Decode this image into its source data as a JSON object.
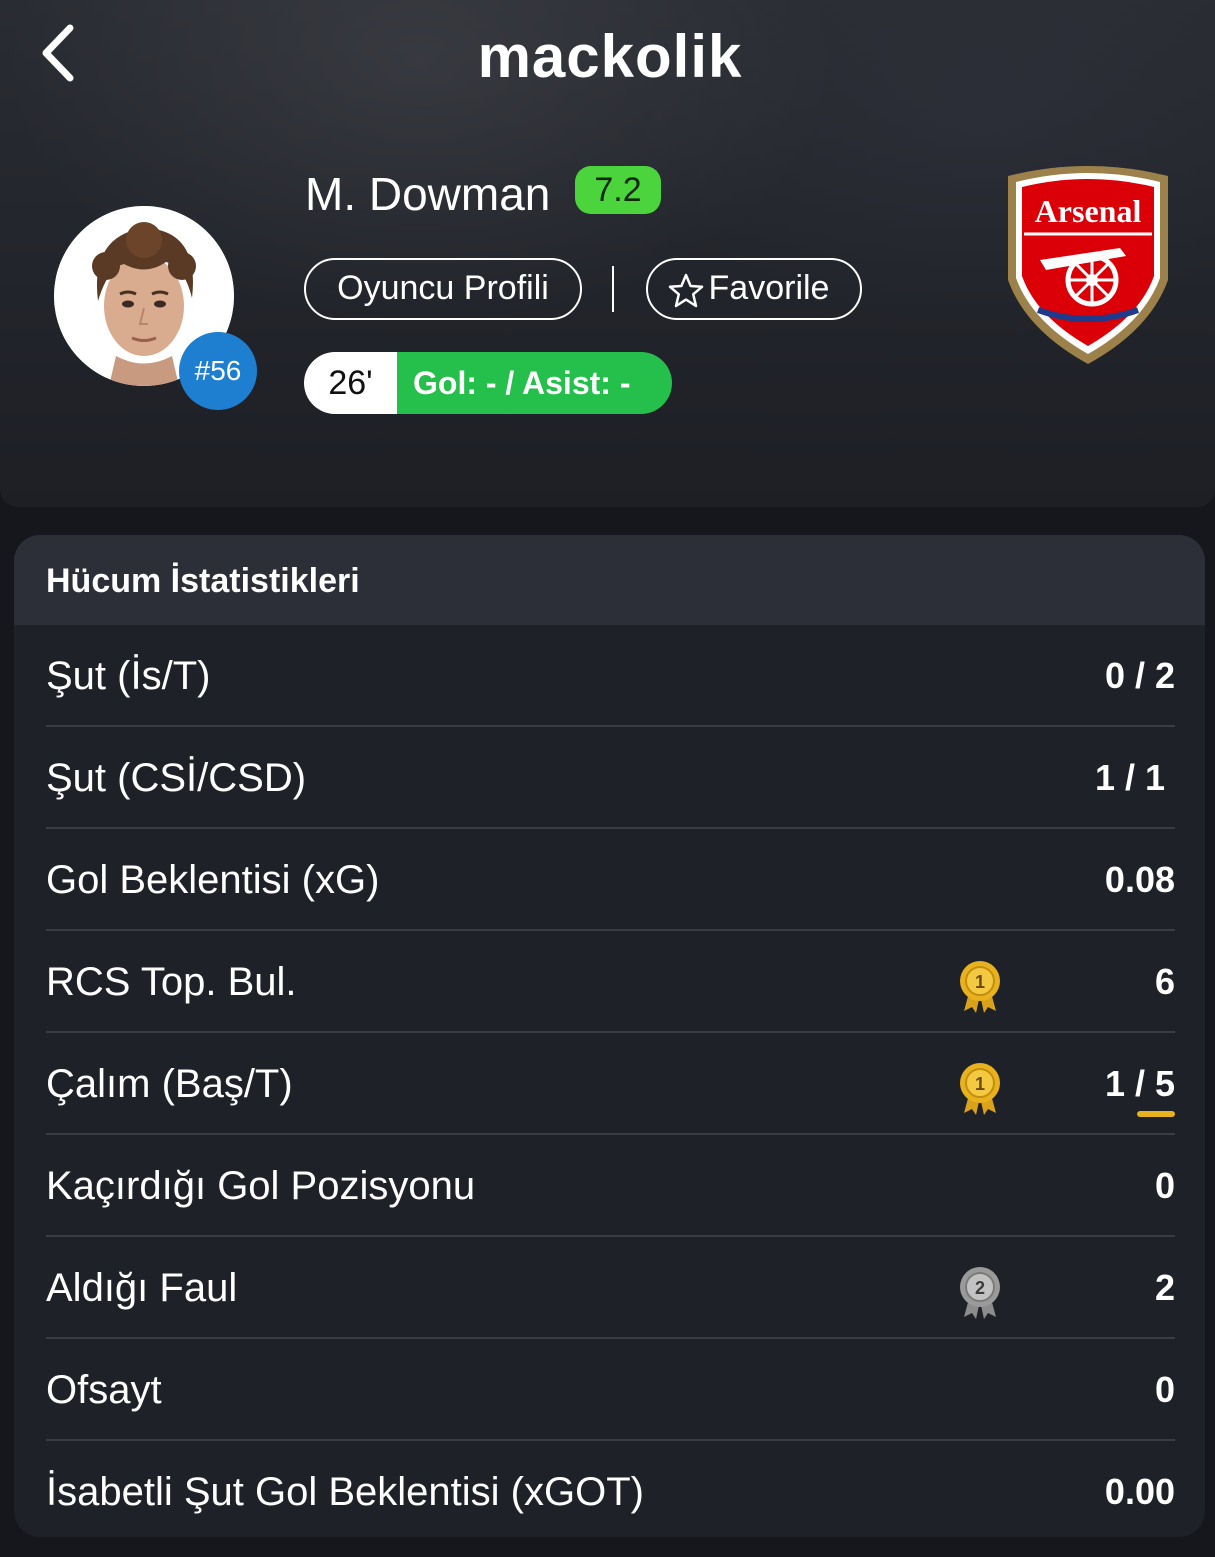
{
  "app": {
    "brand": "mackolik"
  },
  "player": {
    "name": "M. Dowman",
    "rating": "7.2",
    "jersey_number": "#56",
    "minute": "26'",
    "goal_assist": "Gol: - / Asist: -"
  },
  "actions": {
    "profile_label": "Oyuncu Profili",
    "favorite_label": "Favorile"
  },
  "team": {
    "crest_text": "Arsenal"
  },
  "colors": {
    "rating_bg": "#4cd43c",
    "goal_pill_bg": "#25c04b",
    "jersey_badge_bg": "#1e7fd0",
    "gold_medal": "#e7b21d",
    "silver_medal": "#9a9a9a"
  },
  "section": {
    "title": "Hücum İstatistikleri",
    "rows": [
      {
        "label": "Şut (İs/T)",
        "value": "0 / 2"
      },
      {
        "label": "Şut (CSİ/CSD)",
        "value": "1 / 1"
      },
      {
        "label": "Gol Beklentisi (xG)",
        "value": "0.08"
      },
      {
        "label": "RCS Top. Bul.",
        "value": "6",
        "medal": "1"
      },
      {
        "label": "Çalım (Baş/T)",
        "value": "1 / 5",
        "medal": "1"
      },
      {
        "label": "Kaçırdığı Gol Pozisyonu",
        "value": "0"
      },
      {
        "label": "Aldığı Faul",
        "value": "2",
        "medal": "2"
      },
      {
        "label": "Ofsayt",
        "value": "0"
      },
      {
        "label": "İsabetli Şut Gol Beklentisi (xGOT)",
        "value": "0.00"
      }
    ]
  }
}
